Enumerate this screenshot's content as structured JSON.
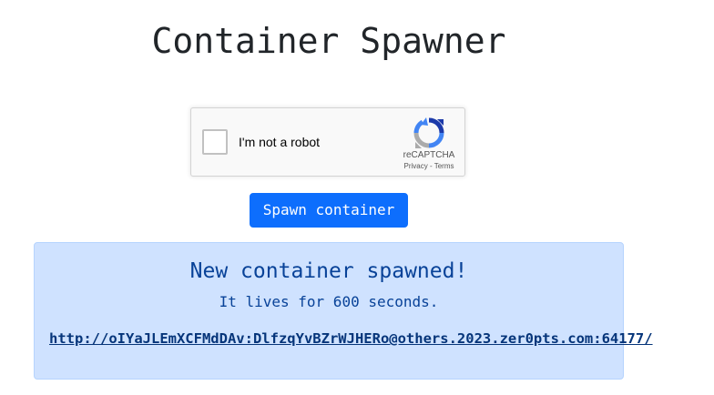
{
  "page": {
    "title": "Container Spawner"
  },
  "recaptcha": {
    "label": "I'm not a robot",
    "brand": "reCAPTCHA",
    "privacy": "Privacy",
    "separator": "-",
    "terms": "Terms",
    "checked": false,
    "icon": "recaptcha-logo-icon"
  },
  "spawn_button": {
    "label": "Spawn container",
    "color": "#0d6efd"
  },
  "alert": {
    "heading": "New container spawned!",
    "subtext": "It lives for 600 seconds.",
    "link": "http://oIYaJLEmXCFMdDAv:DlfzqYvBZrWJHERo@others.2023.zer0pts.com:64177/",
    "background": "#cfe2ff",
    "text_color": "#084298"
  }
}
